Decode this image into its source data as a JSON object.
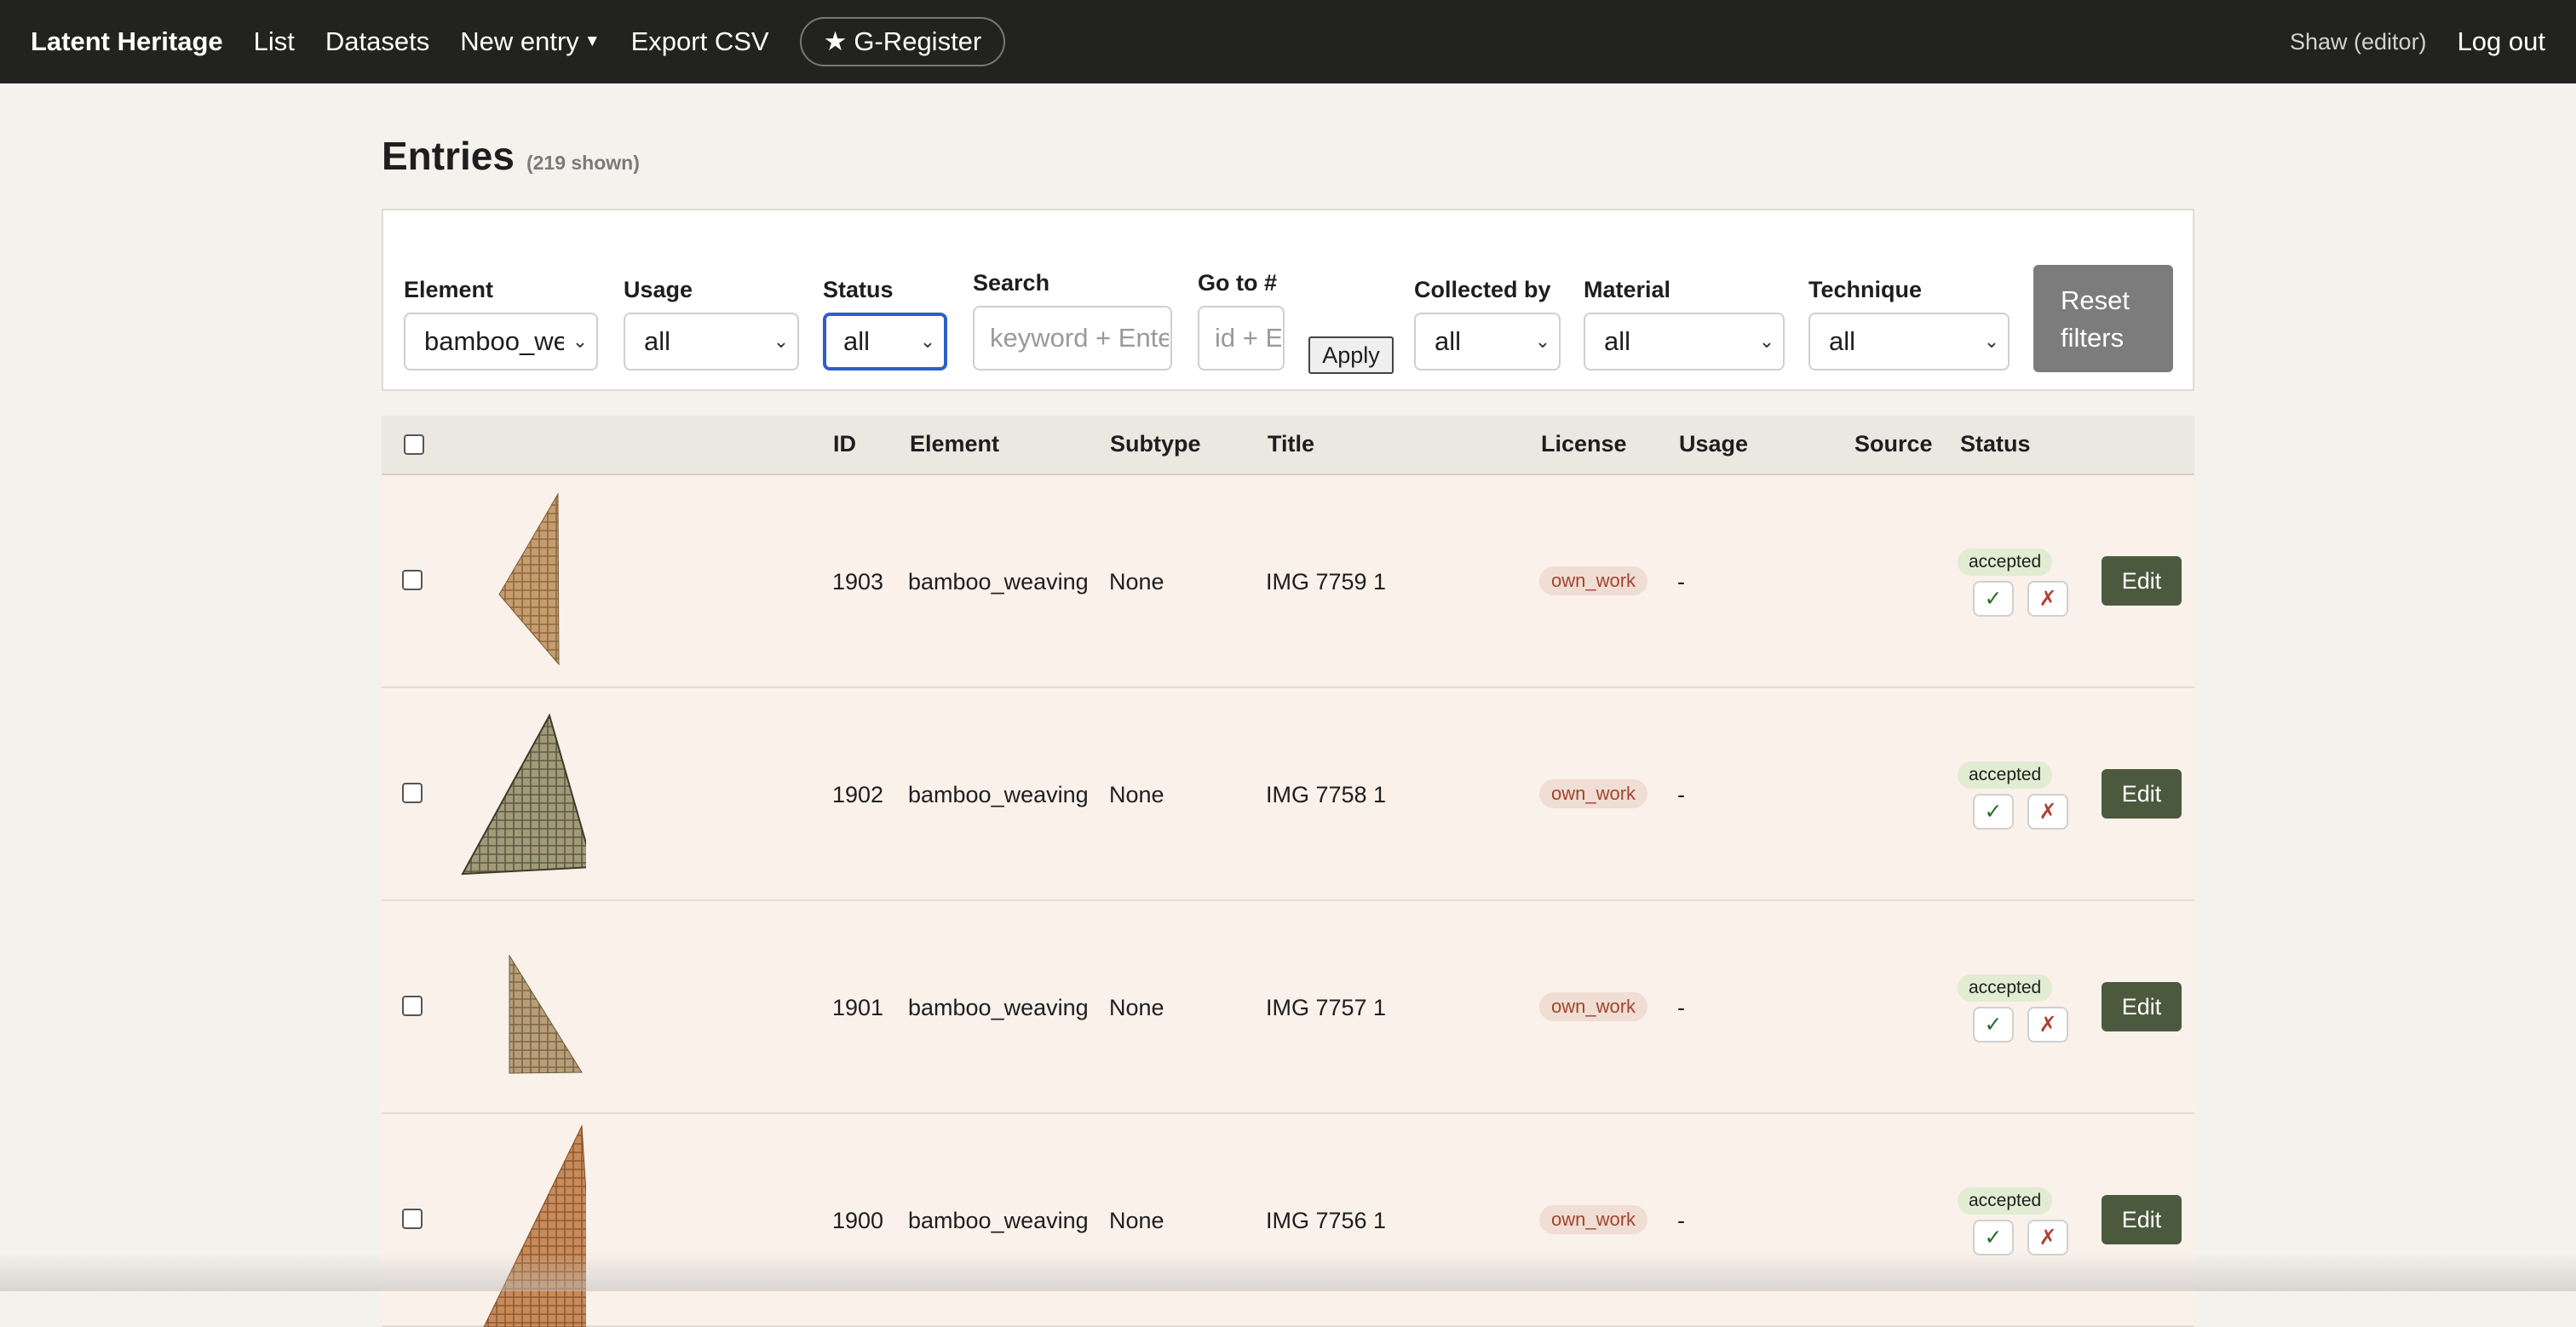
{
  "nav": {
    "brand": "Latent Heritage",
    "list": "List",
    "datasets": "Datasets",
    "new_entry": "New entry",
    "export_csv": "Export CSV",
    "g_register": "G-Register",
    "user": "Shaw (editor)",
    "logout": "Log out"
  },
  "page": {
    "title": "Entries",
    "shown": "(219 shown)"
  },
  "filters": {
    "element": {
      "label": "Element",
      "value": "bamboo_weaving"
    },
    "usage": {
      "label": "Usage",
      "value": "all"
    },
    "status": {
      "label": "Status",
      "value": "all"
    },
    "search": {
      "label": "Search",
      "placeholder": "keyword + Enter"
    },
    "goto": {
      "label": "Go to #",
      "placeholder": "id + Enter"
    },
    "apply": "Apply",
    "collected_by": {
      "label": "Collected by",
      "value": "all"
    },
    "material": {
      "label": "Material",
      "value": "all"
    },
    "technique": {
      "label": "Technique",
      "value": "all"
    },
    "reset_line1": "Reset",
    "reset_line2": "filters"
  },
  "table": {
    "columns": {
      "id": "ID",
      "element": "Element",
      "subtype": "Subtype",
      "title": "Title",
      "license": "License",
      "usage": "Usage",
      "source": "Source",
      "status": "Status"
    },
    "rows": [
      {
        "id": "1903",
        "element": "bamboo_weaving",
        "subtype": "None",
        "title": "IMG 7759 1",
        "license": "own_work",
        "usage": "-",
        "source": "",
        "status": "accepted",
        "accept": "✓",
        "reject": "✗",
        "edit": "Edit"
      },
      {
        "id": "1902",
        "element": "bamboo_weaving",
        "subtype": "None",
        "title": "IMG 7758 1",
        "license": "own_work",
        "usage": "-",
        "source": "",
        "status": "accepted",
        "accept": "✓",
        "reject": "✗",
        "edit": "Edit"
      },
      {
        "id": "1901",
        "element": "bamboo_weaving",
        "subtype": "None",
        "title": "IMG 7757 1",
        "license": "own_work",
        "usage": "-",
        "source": "",
        "status": "accepted",
        "accept": "✓",
        "reject": "✗",
        "edit": "Edit"
      },
      {
        "id": "1900",
        "element": "bamboo_weaving",
        "subtype": "None",
        "title": "IMG 7756 1",
        "license": "own_work",
        "usage": "-",
        "source": "",
        "status": "accepted",
        "accept": "✓",
        "reject": "✗",
        "edit": "Edit"
      }
    ]
  },
  "colors": {
    "nav_bg": "#222220",
    "page_bg": "#f4f2ec",
    "row_bg": "#faf1ea",
    "edit_button": "#4b5a3e",
    "license_badge": "#f0ddd4",
    "status_badge": "#e1ecd2",
    "reset_button": "#7c7c7c",
    "focus_ring": "#2d5fc8"
  }
}
